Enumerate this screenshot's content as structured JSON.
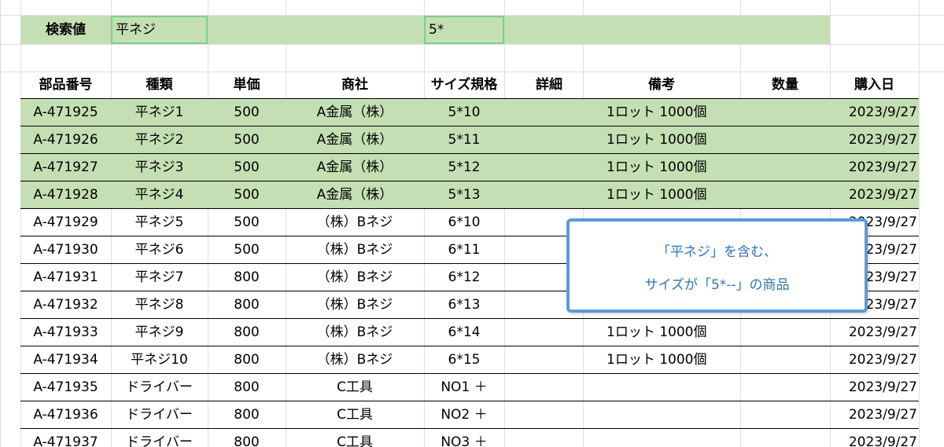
{
  "search": {
    "label": "検索値",
    "keyword_value": "平ネジ",
    "size_value": "5*"
  },
  "columns": {
    "part_no": "部品番号",
    "type": "種類",
    "unit_price": "単価",
    "trading_co": "商社",
    "size": "サイズ規格",
    "detail": "詳細",
    "note": "備考",
    "qty": "数量",
    "purchase_date": "購入日"
  },
  "rows": [
    {
      "part_no": "A-471925",
      "type": "平ネジ1",
      "unit_price": "500",
      "trading_co": "A金属（株）",
      "size": "5*10",
      "detail": "",
      "note": "1ロット 1000個",
      "qty": "",
      "purchase_date": "2023/9/27",
      "highlight": true
    },
    {
      "part_no": "A-471926",
      "type": "平ネジ2",
      "unit_price": "500",
      "trading_co": "A金属（株）",
      "size": "5*11",
      "detail": "",
      "note": "1ロット 1000個",
      "qty": "",
      "purchase_date": "2023/9/27",
      "highlight": true
    },
    {
      "part_no": "A-471927",
      "type": "平ネジ3",
      "unit_price": "500",
      "trading_co": "A金属（株）",
      "size": "5*12",
      "detail": "",
      "note": "1ロット 1000個",
      "qty": "",
      "purchase_date": "2023/9/27",
      "highlight": true
    },
    {
      "part_no": "A-471928",
      "type": "平ネジ4",
      "unit_price": "500",
      "trading_co": "A金属（株）",
      "size": "5*13",
      "detail": "",
      "note": "1ロット 1000個",
      "qty": "",
      "purchase_date": "2023/9/27",
      "highlight": true
    },
    {
      "part_no": "A-471929",
      "type": "平ネジ5",
      "unit_price": "500",
      "trading_co": "（株）Bネジ",
      "size": "6*10",
      "detail": "",
      "note": "",
      "qty": "",
      "purchase_date": "2023/9/27",
      "highlight": false
    },
    {
      "part_no": "A-471930",
      "type": "平ネジ6",
      "unit_price": "500",
      "trading_co": "（株）Bネジ",
      "size": "6*11",
      "detail": "",
      "note": "",
      "qty": "",
      "purchase_date": "2023/9/27",
      "highlight": false
    },
    {
      "part_no": "A-471931",
      "type": "平ネジ7",
      "unit_price": "800",
      "trading_co": "（株）Bネジ",
      "size": "6*12",
      "detail": "",
      "note": "",
      "qty": "",
      "purchase_date": "2023/9/27",
      "highlight": false
    },
    {
      "part_no": "A-471932",
      "type": "平ネジ8",
      "unit_price": "800",
      "trading_co": "（株）Bネジ",
      "size": "6*13",
      "detail": "",
      "note": "",
      "qty": "",
      "purchase_date": "2023/9/27",
      "highlight": false
    },
    {
      "part_no": "A-471933",
      "type": "平ネジ9",
      "unit_price": "800",
      "trading_co": "（株）Bネジ",
      "size": "6*14",
      "detail": "",
      "note": "1ロット 1000個",
      "qty": "",
      "purchase_date": "2023/9/27",
      "highlight": false
    },
    {
      "part_no": "A-471934",
      "type": "平ネジ10",
      "unit_price": "800",
      "trading_co": "（株）Bネジ",
      "size": "6*15",
      "detail": "",
      "note": "1ロット 1000個",
      "qty": "",
      "purchase_date": "2023/9/27",
      "highlight": false
    },
    {
      "part_no": "A-471935",
      "type": "ドライバー",
      "unit_price": "800",
      "trading_co": "C工具",
      "size": "NO1 ＋",
      "detail": "",
      "note": "",
      "qty": "",
      "purchase_date": "2023/9/27",
      "highlight": false
    },
    {
      "part_no": "A-471936",
      "type": "ドライバー",
      "unit_price": "800",
      "trading_co": "C工具",
      "size": "NO2 ＋",
      "detail": "",
      "note": "",
      "qty": "",
      "purchase_date": "2023/9/27",
      "highlight": false
    },
    {
      "part_no": "A-471937",
      "type": "ドライバー",
      "unit_price": "800",
      "trading_co": "C工具",
      "size": "NO3 ＋",
      "detail": "",
      "note": "",
      "qty": "",
      "purchase_date": "2023/9/27",
      "highlight": false
    }
  ],
  "callout": {
    "line1": "「平ネジ」を含む、",
    "line2": "サイズが「5*--」の商品"
  },
  "colors": {
    "highlight": "#c5dfb4",
    "input_border": "#7ad08a",
    "callout_border": "#5b9bd5",
    "callout_text": "#2e75b6"
  }
}
